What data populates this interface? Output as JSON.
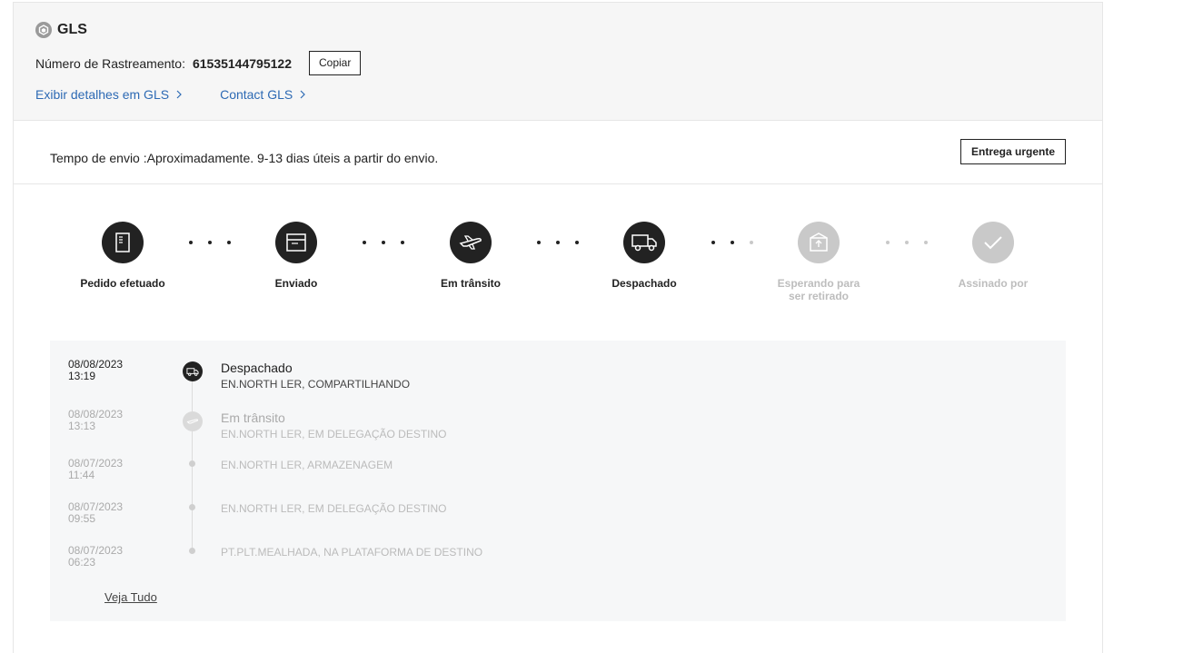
{
  "carrier": {
    "name": "GLS",
    "logo_icon": "gls-logo-icon"
  },
  "tracking": {
    "label": "Número de Rastreamento:",
    "number": "61535144795122",
    "copy_label": "Copiar"
  },
  "links": {
    "details": "Exibir detalhes em GLS",
    "contact": "Contact GLS"
  },
  "shipping": {
    "time_text": "Tempo de envio :Aproximadamente. 9-13 dias úteis a partir do envio.",
    "urgent_label": "Entrega urgente"
  },
  "steps": [
    {
      "label": "Pedido efetuado",
      "icon": "document-icon",
      "state": "done"
    },
    {
      "label": "Enviado",
      "icon": "package-icon",
      "state": "done"
    },
    {
      "label": "Em trânsito",
      "icon": "airplane-icon",
      "state": "done"
    },
    {
      "label": "Despachado",
      "icon": "truck-icon",
      "state": "done"
    },
    {
      "label": "Esperando para ser retirado",
      "icon": "pickup-box-icon",
      "state": "pending"
    },
    {
      "label": "Assinado por",
      "icon": "check-icon",
      "state": "pending"
    }
  ],
  "events": [
    {
      "date": "08/08/2023",
      "time": "13:19",
      "title": "Despachado",
      "desc": "EN.NORTH LER, COMPARTILHANDO",
      "active": true
    },
    {
      "date": "08/08/2023",
      "time": "13:13",
      "title": "Em trânsito",
      "desc": "EN.NORTH LER, EM DELEGAÇÃO DESTINO",
      "active": false
    },
    {
      "date": "08/07/2023",
      "time": "11:44",
      "title": "",
      "desc": "EN.NORTH LER, ARMAZENAGEM",
      "active": false
    },
    {
      "date": "08/07/2023",
      "time": "09:55",
      "title": "",
      "desc": "EN.NORTH LER, EM DELEGAÇÃO DESTINO",
      "active": false
    },
    {
      "date": "08/07/2023",
      "time": "06:23",
      "title": "",
      "desc": "PT.PLT.MEALHADA, NA PLATAFORMA DE DESTINO",
      "active": false
    }
  ],
  "see_all_label": "Veja Tudo",
  "colors": {
    "link": "#2d6ab4",
    "done": "#222222",
    "pending": "#c9c9c9",
    "header_bg": "#f6f6f6",
    "timeline_bg": "#f6f7f8"
  }
}
